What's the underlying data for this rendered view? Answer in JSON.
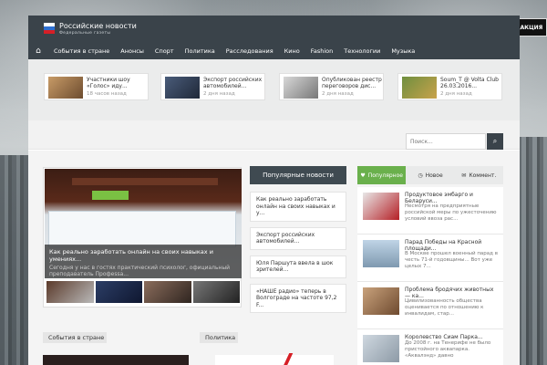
{
  "site": {
    "title": "Российские новости",
    "subtitle": "Федеральные газеты",
    "editorial_button": "РЕДАКЦИЯ"
  },
  "nav": {
    "home_icon": "home-icon",
    "items": [
      "События в стране",
      "Анонсы",
      "Спорт",
      "Политика",
      "Расследования",
      "Кино",
      "Fashion",
      "Технологии",
      "Музыка"
    ]
  },
  "ticker": [
    {
      "title": "Участники шоу «Голос» иду...",
      "time": "18 часов назад"
    },
    {
      "title": "Экспорт российских автомобилей...",
      "time": "2 дня назад"
    },
    {
      "title": "Опубликован реестр переговоров дис...",
      "time": "2 дня назад"
    },
    {
      "title": "Soum_T @ Volta Club 26.03.2016...",
      "time": "2 дня назад"
    }
  ],
  "search": {
    "placeholder": "Поиск...",
    "icon": "search-icon"
  },
  "slider": {
    "caption_title": "Как реально заработать онлайн на своих навыках и умениях...",
    "caption_text": "Сегодня у нас в гостях практический психолог, официальный преподаватель Профеssa..."
  },
  "popular": {
    "heading": "Популярные новости",
    "items": [
      "Как реально заработать онлайн на своих навыках и у...",
      "Экспорт российских автомобилей...",
      "Юля Паршута ввела в шок зрителей...",
      "«НАШЕ радио» теперь в Волгограде на частоте 97,2 F..."
    ]
  },
  "tabs": [
    {
      "label": "Популярное",
      "icon": "heart-icon",
      "active": true
    },
    {
      "label": "Новое",
      "icon": "clock-icon",
      "active": false
    },
    {
      "label": "Коммент.",
      "icon": "comments-icon",
      "active": false
    }
  ],
  "side_items": [
    {
      "title": "Продуктовое эмбарго и Беларуси...",
      "date": "",
      "excerpt": "Несмотря на предприятные российской меры по ужесточению условий ввоза рас..."
    },
    {
      "title": "Парад Победы на Красной площади...",
      "date": "",
      "excerpt": "В Москве прошел военный парад в честь 71-й годовщины... Вот уже целых 7..."
    },
    {
      "title": "Проблема бродячих животных — ка...",
      "date": "",
      "excerpt": "Цивилизованность общества оценивается по отношению к инвалидам, стар..."
    },
    {
      "title": "Королевство Сиам Парка...",
      "date": "До 2008 г. на Тенерифе не было пристойного аквапарка. «Аквалэнд» давно",
      "excerpt": ""
    }
  ],
  "sections": {
    "left": "События в стране",
    "right": "Политика"
  },
  "colors": {
    "header": "#3a434a",
    "accent_green": "#6ab04c",
    "accent_red": "#d61f26"
  }
}
